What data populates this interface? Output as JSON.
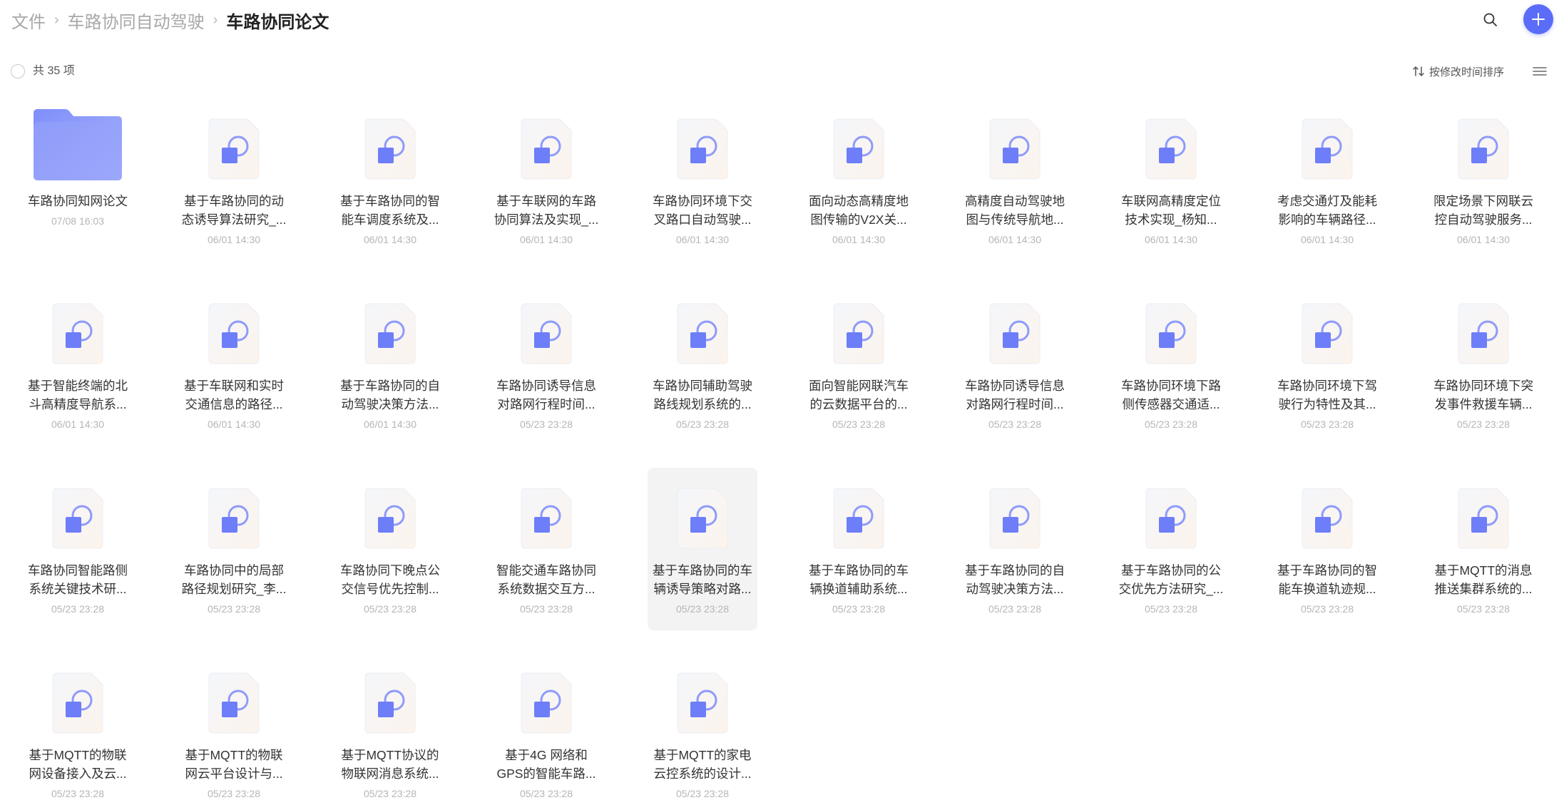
{
  "breadcrumb": {
    "root": "文件",
    "parent": "车路协同自动驾驶",
    "current": "车路协同论文"
  },
  "toolbar": {
    "count_label": "共 35 项",
    "sort_label": "按修改时间排序"
  },
  "icons": {
    "search": "search-icon",
    "add": "plus-icon",
    "sort": "sort-arrows-icon",
    "menu": "list-view-icon",
    "folder": "folder-icon",
    "file": "document-icon"
  },
  "colors": {
    "accent": "#5b6cf9",
    "folder": "#8e9bfb",
    "doc_bg": "#faf7f4"
  },
  "items": [
    {
      "type": "folder",
      "line1": "车路协同知网论文",
      "line2": "",
      "date": "07/08 16:03"
    },
    {
      "type": "file",
      "line1": "基于车路协同的动",
      "line2": "态诱导算法研究_...",
      "date": "06/01 14:30"
    },
    {
      "type": "file",
      "line1": "基于车路协同的智",
      "line2": "能车调度系统及...",
      "date": "06/01 14:30"
    },
    {
      "type": "file",
      "line1": "基于车联网的车路",
      "line2": "协同算法及实现_...",
      "date": "06/01 14:30"
    },
    {
      "type": "file",
      "line1": "车路协同环境下交",
      "line2": "叉路口自动驾驶...",
      "date": "06/01 14:30"
    },
    {
      "type": "file",
      "line1": "面向动态高精度地",
      "line2": "图传输的V2X关...",
      "date": "06/01 14:30"
    },
    {
      "type": "file",
      "line1": "高精度自动驾驶地",
      "line2": "图与传统导航地...",
      "date": "06/01 14:30"
    },
    {
      "type": "file",
      "line1": "车联网高精度定位",
      "line2": "技术实现_杨知...",
      "date": "06/01 14:30"
    },
    {
      "type": "file",
      "line1": "考虑交通灯及能耗",
      "line2": "影响的车辆路径...",
      "date": "06/01 14:30"
    },
    {
      "type": "file",
      "line1": "限定场景下网联云",
      "line2": "控自动驾驶服务...",
      "date": "06/01 14:30"
    },
    {
      "type": "file",
      "line1": "基于智能终端的北",
      "line2": "斗高精度导航系...",
      "date": "06/01 14:30"
    },
    {
      "type": "file",
      "line1": "基于车联网和实时",
      "line2": "交通信息的路径...",
      "date": "06/01 14:30"
    },
    {
      "type": "file",
      "line1": "基于车路协同的自",
      "line2": "动驾驶决策方法...",
      "date": "06/01 14:30"
    },
    {
      "type": "file",
      "line1": "车路协同诱导信息",
      "line2": "对路网行程时间...",
      "date": "05/23 23:28"
    },
    {
      "type": "file",
      "line1": "车路协同辅助驾驶",
      "line2": "路线规划系统的...",
      "date": "05/23 23:28"
    },
    {
      "type": "file",
      "line1": "面向智能网联汽车",
      "line2": "的云数据平台的...",
      "date": "05/23 23:28"
    },
    {
      "type": "file",
      "line1": "车路协同诱导信息",
      "line2": "对路网行程时间...",
      "date": "05/23 23:28"
    },
    {
      "type": "file",
      "line1": "车路协同环境下路",
      "line2": "侧传感器交通适...",
      "date": "05/23 23:28"
    },
    {
      "type": "file",
      "line1": "车路协同环境下驾",
      "line2": "驶行为特性及其...",
      "date": "05/23 23:28"
    },
    {
      "type": "file",
      "line1": "车路协同环境下突",
      "line2": "发事件救援车辆...",
      "date": "05/23 23:28"
    },
    {
      "type": "file",
      "line1": "车路协同智能路侧",
      "line2": "系统关键技术研...",
      "date": "05/23 23:28"
    },
    {
      "type": "file",
      "line1": "车路协同中的局部",
      "line2": "路径规划研究_李...",
      "date": "05/23 23:28"
    },
    {
      "type": "file",
      "line1": "车路协同下晚点公",
      "line2": "交信号优先控制...",
      "date": "05/23 23:28"
    },
    {
      "type": "file",
      "line1": "智能交通车路协同",
      "line2": "系统数据交互方...",
      "date": "05/23 23:28"
    },
    {
      "type": "file",
      "line1": "基于车路协同的车",
      "line2": "辆诱导策略对路...",
      "date": "05/23 23:28",
      "selected": true
    },
    {
      "type": "file",
      "line1": "基于车路协同的车",
      "line2": "辆换道辅助系统...",
      "date": "05/23 23:28"
    },
    {
      "type": "file",
      "line1": "基于车路协同的自",
      "line2": "动驾驶决策方法...",
      "date": "05/23 23:28"
    },
    {
      "type": "file",
      "line1": "基于车路协同的公",
      "line2": "交优先方法研究_...",
      "date": "05/23 23:28"
    },
    {
      "type": "file",
      "line1": "基于车路协同的智",
      "line2": "能车换道轨迹规...",
      "date": "05/23 23:28"
    },
    {
      "type": "file",
      "line1": "基于MQTT的消息",
      "line2": "推送集群系统的...",
      "date": "05/23 23:28"
    },
    {
      "type": "file",
      "line1": "基于MQTT的物联",
      "line2": "网设备接入及云...",
      "date": "05/23 23:28"
    },
    {
      "type": "file",
      "line1": "基于MQTT的物联",
      "line2": "网云平台设计与...",
      "date": "05/23 23:28"
    },
    {
      "type": "file",
      "line1": "基于MQTT协议的",
      "line2": "物联网消息系统...",
      "date": "05/23 23:28"
    },
    {
      "type": "file",
      "line1": "基于4G 网络和",
      "line2": "GPS的智能车路...",
      "date": "05/23 23:28"
    },
    {
      "type": "file",
      "line1": "基于MQTT的家电",
      "line2": "云控系统的设计...",
      "date": "05/23 23:28"
    }
  ]
}
